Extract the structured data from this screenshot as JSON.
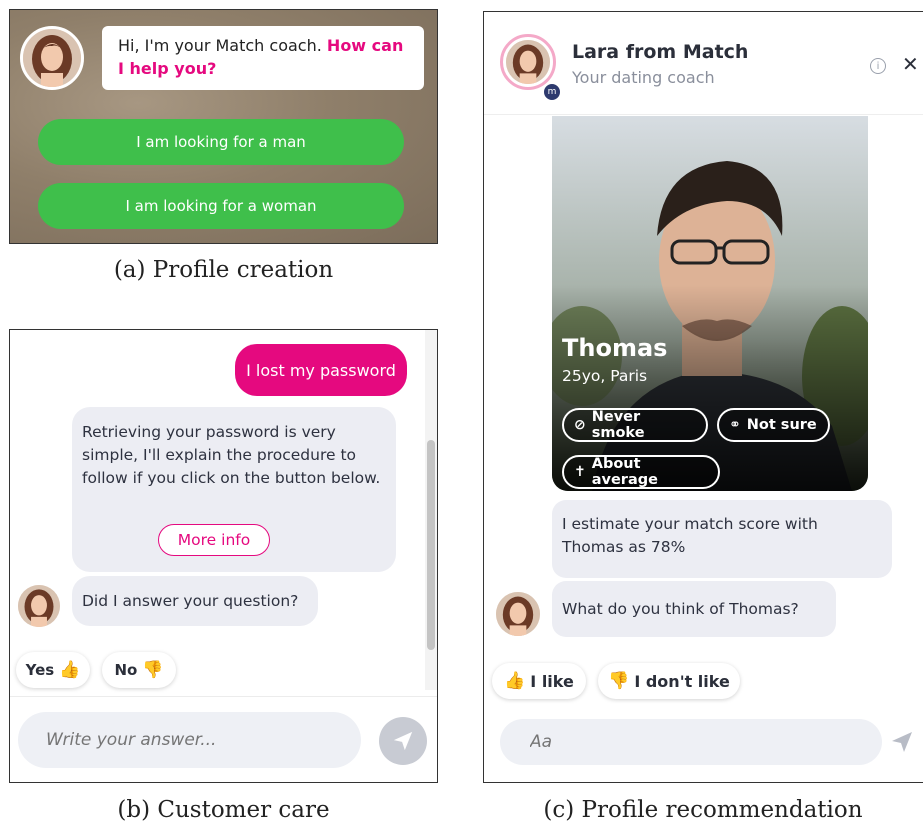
{
  "panel_a": {
    "caption": "(a) Profile creation",
    "coach_text": "Hi, I'm your Match coach.",
    "coach_highlight": "How can I help you?",
    "buttons": [
      "I am looking for a man",
      "I am looking for a woman"
    ]
  },
  "panel_b": {
    "caption": "(b) Customer care",
    "user_message": "I lost my password",
    "bot_message": "Retrieving your password is very simple, I'll explain the procedure to follow if you click on the button below.",
    "more_info": "More info",
    "question": "Did I answer your question?",
    "quick_replies": [
      "Yes",
      "No"
    ],
    "input_placeholder": "Write your answer..."
  },
  "panel_c": {
    "caption": "(c) Profile recommendation",
    "coach_name": "Lara from Match",
    "coach_role": "Your dating coach",
    "profile": {
      "name": "Thomas",
      "details": "25yo, Paris",
      "chips": [
        "Never smoke",
        "Not sure",
        "About average"
      ]
    },
    "estimate_message": "I estimate your match score with Thomas as 78%",
    "question": "What do you think of Thomas?",
    "quick_replies": [
      "I like",
      "I don't like"
    ],
    "input_placeholder": "Aa"
  },
  "colors": {
    "pink": "#e5097f",
    "green": "#3fbf4b",
    "bubble_gray": "#ecedf3"
  },
  "icons": [
    "avatar",
    "thumbs-up-icon",
    "thumbs-down-icon",
    "send-icon",
    "info-icon",
    "close-icon",
    "no-smoking-icon",
    "link-icon",
    "person-icon",
    "match-badge-icon"
  ]
}
